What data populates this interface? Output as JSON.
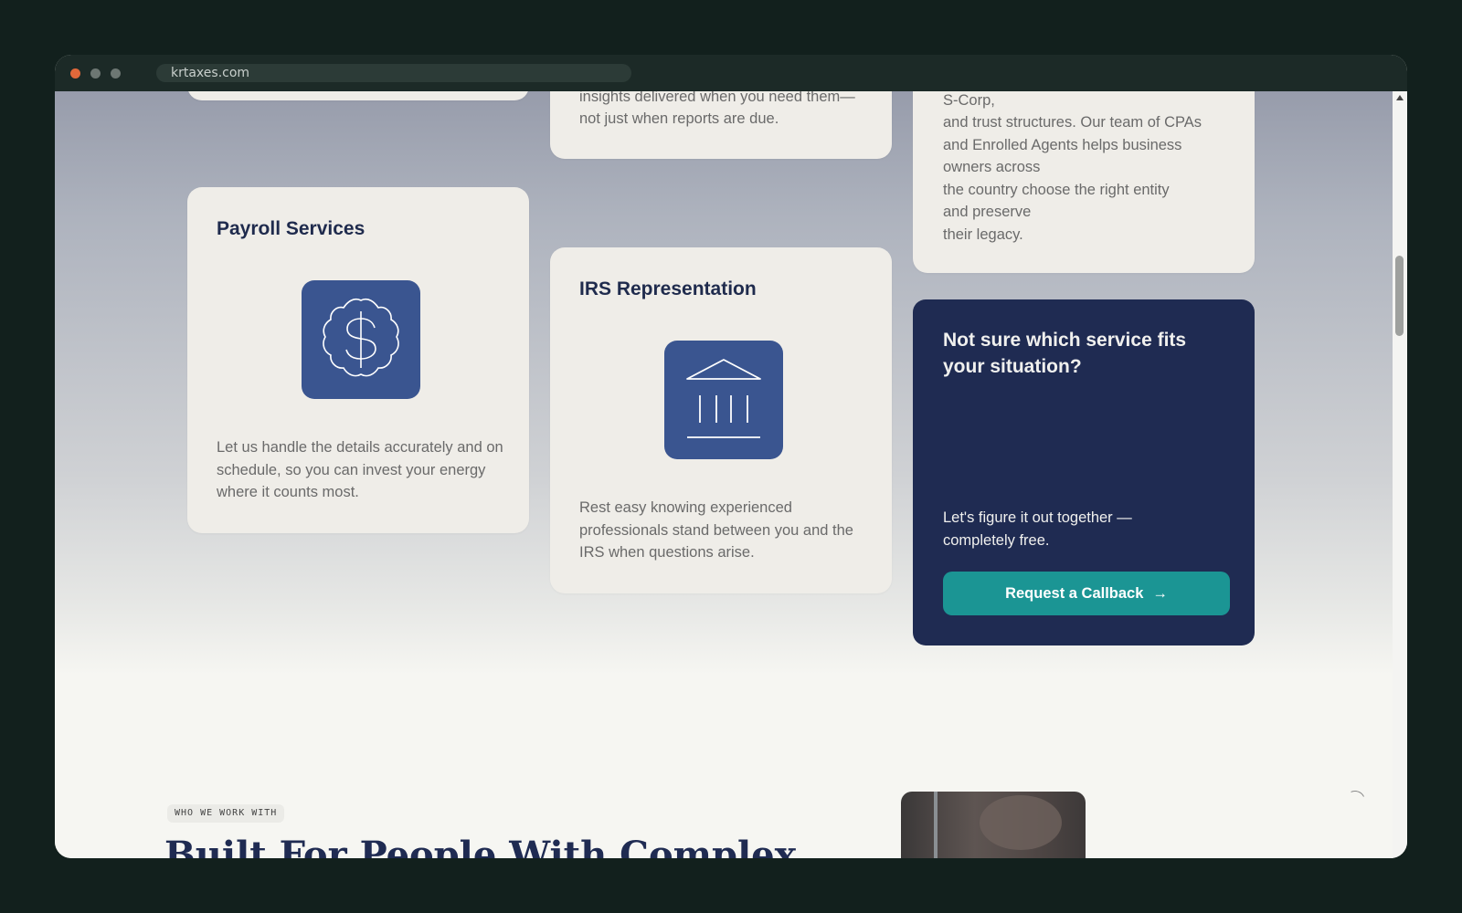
{
  "browser": {
    "url": "krtaxes.com"
  },
  "services": {
    "advisory_card": {
      "desc_line1": "insights delivered when you need them—",
      "desc_line2": "not just when reports are due."
    },
    "entity_card": {
      "lines": [
        "S-Corp,",
        "and trust structures. Our team of CPAs",
        "and Enrolled Agents helps business",
        "owners across",
        "the country choose the right entity",
        "and preserve",
        "their legacy."
      ]
    },
    "payroll_card": {
      "title": "Payroll Services",
      "icon": "dollar-badge-icon",
      "desc": "Let us handle the details accurately and on schedule, so you can invest your energy where it counts most."
    },
    "irs_card": {
      "title": "IRS Representation",
      "icon": "bank-building-icon",
      "desc": "Rest easy knowing experienced professionals stand between you and the IRS when questions arise."
    },
    "cta_card": {
      "title": "Not sure which service fits your situation?",
      "subtitle": "Let's figure it out together — completely free.",
      "button_label": "Request a Callback",
      "button_icon": "arrow-right-icon"
    }
  },
  "who_we_work_with": {
    "badge": "WHO WE WORK WITH",
    "heading": "Built For People With Complex"
  },
  "colors": {
    "navy": "#1f2b52",
    "icon_blue": "#3a5590",
    "teal": "#1b9594",
    "card_bg": "#efede8"
  }
}
